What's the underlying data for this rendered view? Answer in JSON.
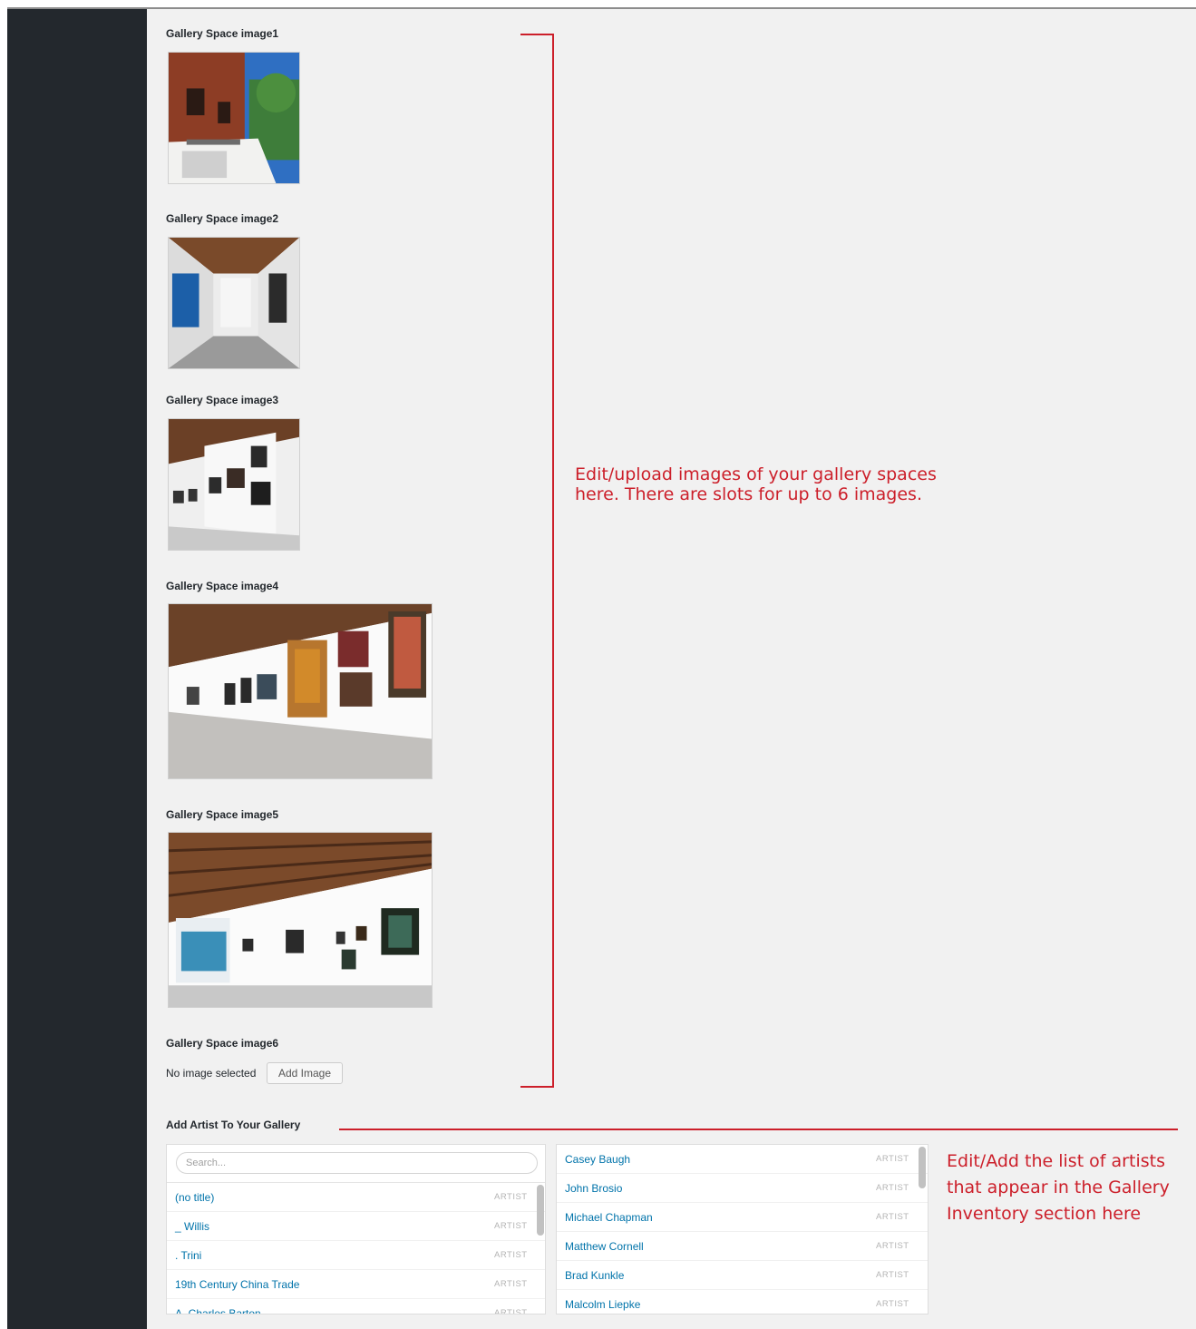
{
  "gallery_images": {
    "image1_label": "Gallery Space image1",
    "image2_label": "Gallery Space image2",
    "image3_label": "Gallery Space image3",
    "image4_label": "Gallery Space image4",
    "image5_label": "Gallery Space image5",
    "image6_label": "Gallery Space image6",
    "image6_status": "No image selected",
    "add_image_label": "Add Image"
  },
  "annotations": {
    "images_note": "Edit/upload images of your gallery spaces here. There are slots for up to 6 images.",
    "artists_note": "Edit/Add the list of artists that appear in the Gallery Inventory section here",
    "color": "#cc1f2a"
  },
  "artists": {
    "section_label": "Add Artist To Your Gallery",
    "search_placeholder": "Search...",
    "available": [
      {
        "name": "(no title)",
        "type": "ARTIST"
      },
      {
        "name": "_ Willis",
        "type": "ARTIST"
      },
      {
        "name": ". Trini",
        "type": "ARTIST"
      },
      {
        "name": "19th Century China Trade",
        "type": "ARTIST"
      },
      {
        "name": "A. Charles Barton",
        "type": "ARTIST"
      }
    ],
    "selected": [
      {
        "name": "Casey Baugh",
        "type": "ARTIST"
      },
      {
        "name": "John Brosio",
        "type": "ARTIST"
      },
      {
        "name": "Michael Chapman",
        "type": "ARTIST"
      },
      {
        "name": "Matthew Cornell",
        "type": "ARTIST"
      },
      {
        "name": "Brad Kunkle",
        "type": "ARTIST"
      },
      {
        "name": "Malcolm Liepke",
        "type": "ARTIST"
      }
    ]
  },
  "colors": {
    "sidebar": "#23282d",
    "content_bg": "#f1f1f1",
    "link": "#0073aa"
  }
}
